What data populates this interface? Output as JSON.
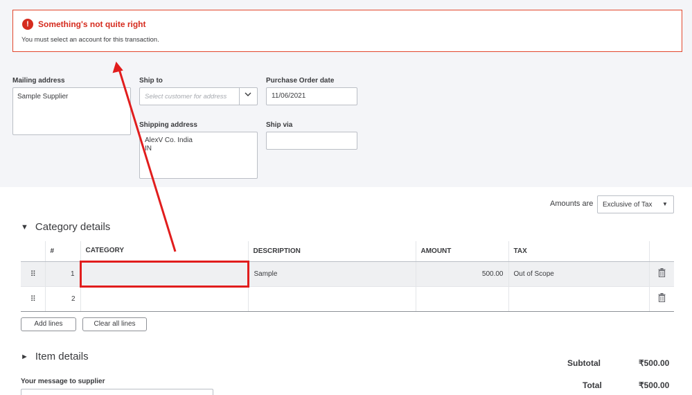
{
  "error": {
    "title": "Something's not quite right",
    "message": "You must select an account for this transaction.",
    "icon": "exclamation-icon",
    "color": "#d52b1e"
  },
  "form": {
    "mailing_label": "Mailing address",
    "mailing_value": "Sample Supplier",
    "shipto_label": "Ship to",
    "shipto_placeholder": "Select customer for address",
    "pod_label": "Purchase Order date",
    "pod_value": "11/06/2021",
    "shipping_label": "Shipping address",
    "shipping_line1": "AlexV Co. India",
    "shipping_line2": "IN",
    "shipvia_label": "Ship via",
    "shipvia_value": ""
  },
  "amounts": {
    "label": "Amounts are",
    "selected": "Exclusive of Tax"
  },
  "category_section": {
    "title": "Category details",
    "columns": [
      "#",
      "CATEGORY",
      "DESCRIPTION",
      "AMOUNT",
      "TAX"
    ],
    "rows": [
      {
        "num": "1",
        "category": "",
        "description": "Sample",
        "amount": "500.00",
        "tax": "Out of Scope"
      },
      {
        "num": "2",
        "category": "",
        "description": "",
        "amount": "",
        "tax": ""
      }
    ],
    "add_lines": "Add lines",
    "clear_lines": "Clear all lines"
  },
  "item_section": {
    "title": "Item details"
  },
  "totals": {
    "subtotal_label": "Subtotal",
    "subtotal_value": "₹500.00",
    "total_label": "Total",
    "total_value": "₹500.00"
  },
  "message": {
    "label": "Your message to supplier",
    "value": ""
  },
  "annotation_color": "#e11d1d"
}
